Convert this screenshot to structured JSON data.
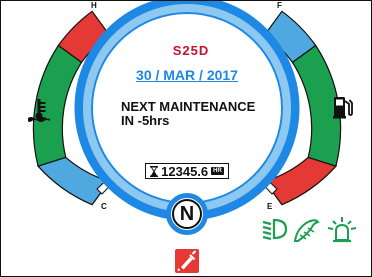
{
  "brand": "S25D",
  "date": "30 / MAR / 2017",
  "maintenance": {
    "line1": "NEXT MAINTENANCE",
    "line2": "IN -5hrs"
  },
  "hour_meter": {
    "value": "12345.6",
    "unit": "HR"
  },
  "gear": "N",
  "temp_gauge": {
    "high_label": "H",
    "low_label": "C",
    "level_fraction": 0.1
  },
  "fuel_gauge": {
    "full_label": "F",
    "empty_label": "E",
    "level_fraction": 0.1
  },
  "colors": {
    "red": "#e53935",
    "green": "#1aa04f",
    "blue": "#4fa8e0",
    "ring_blue": "#1e88e5",
    "ring_light": "#8cc8ef"
  },
  "icons": {
    "temperature": "coolant-temperature-icon",
    "fuel": "fuel-pump-icon",
    "headlight": "low-beam-headlight-icon",
    "washer": "washer-icon",
    "beacon": "beacon-light-icon",
    "warning": "glow-plug-warning-icon"
  }
}
